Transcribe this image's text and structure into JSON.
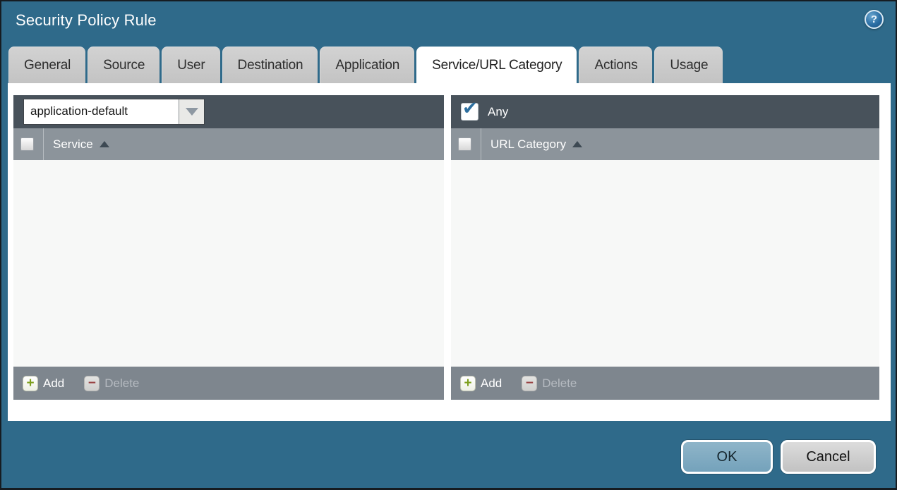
{
  "dialog": {
    "title": "Security Policy Rule",
    "colors": {
      "background_teal": "#2f6a8a",
      "panel_topbar": "#48525b",
      "panel_header": "#8c949b",
      "panel_footer": "#7e868e",
      "panel_body": "#f7f8f7",
      "tab_inactive": "#c7c7c7",
      "tab_active": "#ffffff",
      "ok_button": "#7da9bf",
      "cancel_button": "#cbcbcb",
      "add_plus_green": "#7d9f1c",
      "delete_minus_red": "#994444",
      "checkmark_blue": "#2d6f9f"
    }
  },
  "icons": {
    "help": "?",
    "plus": "+",
    "minus": "−",
    "check": "✔"
  },
  "tabs": [
    {
      "id": "general",
      "label": "General",
      "active": false
    },
    {
      "id": "source",
      "label": "Source",
      "active": false
    },
    {
      "id": "user",
      "label": "User",
      "active": false
    },
    {
      "id": "destination",
      "label": "Destination",
      "active": false
    },
    {
      "id": "application",
      "label": "Application",
      "active": false
    },
    {
      "id": "service-url-category",
      "label": "Service/URL Category",
      "active": true
    },
    {
      "id": "actions",
      "label": "Actions",
      "active": false
    },
    {
      "id": "usage",
      "label": "Usage",
      "active": false
    }
  ],
  "service_panel": {
    "dropdown": {
      "value": "application-default",
      "icon": "chevron-down-icon"
    },
    "header": {
      "label": "Service",
      "sort": "asc",
      "select_all_checked": false
    },
    "rows": [],
    "footer": {
      "add_label": "Add",
      "delete_label": "Delete",
      "delete_enabled": false
    }
  },
  "url_category_panel": {
    "any_checkbox": {
      "label": "Any",
      "checked": true
    },
    "header": {
      "label": "URL Category",
      "sort": "asc",
      "select_all_checked": false
    },
    "rows": [],
    "footer": {
      "add_label": "Add",
      "delete_label": "Delete",
      "delete_enabled": false
    }
  },
  "footer_buttons": {
    "ok_label": "OK",
    "cancel_label": "Cancel"
  }
}
